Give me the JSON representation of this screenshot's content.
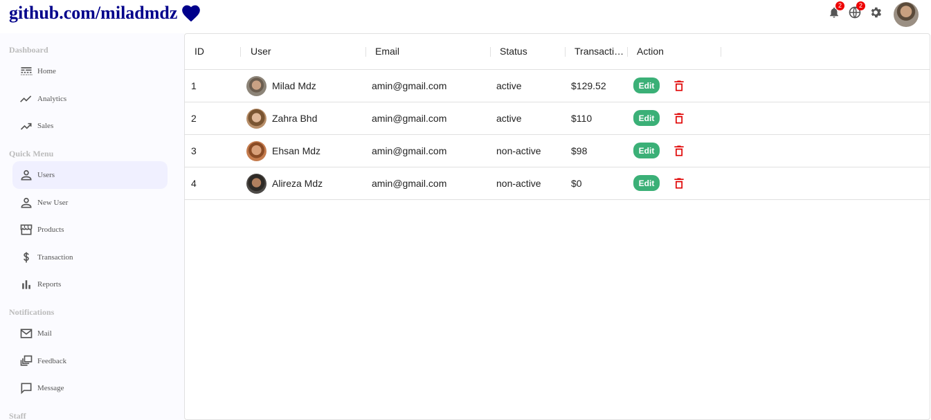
{
  "header": {
    "logo_text": "github.com/miladmdz",
    "notifications_count": "2",
    "language_count": "2"
  },
  "colors": {
    "logo": "#00008b",
    "edit_button": "#3bb077",
    "delete_icon": "#e00000",
    "badge": "#e00000",
    "active_item_bg": "#f0f0ff"
  },
  "sidebar": {
    "sections": {
      "dashboard": "Dashboard",
      "quick_menu": "Quick Menu",
      "notifications": "Notifications",
      "staff": "Staff"
    },
    "items": [
      {
        "label": "Home",
        "icon": "line-style-icon"
      },
      {
        "label": "Analytics",
        "icon": "timeline-icon"
      },
      {
        "label": "Sales",
        "icon": "trending-up-icon"
      },
      {
        "label": "Users",
        "icon": "person-outline-icon",
        "active": true
      },
      {
        "label": "New User",
        "icon": "person-outline-icon"
      },
      {
        "label": "Products",
        "icon": "storefront-icon"
      },
      {
        "label": "Transaction",
        "icon": "dollar-icon"
      },
      {
        "label": "Reports",
        "icon": "bar-chart-icon"
      },
      {
        "label": "Mail",
        "icon": "mail-outline-icon"
      },
      {
        "label": "Feedback",
        "icon": "dynamic-feed-icon"
      },
      {
        "label": "Message",
        "icon": "chat-bubble-outline-icon"
      }
    ]
  },
  "table": {
    "columns": [
      "ID",
      "User",
      "Email",
      "Status",
      "Transaction Volume",
      "Action"
    ],
    "edit_label": "Edit",
    "rows": [
      {
        "id": "1",
        "user": "Milad Mdz",
        "email": "amin@gmail.com",
        "status": "active",
        "transaction": "$129.52"
      },
      {
        "id": "2",
        "user": "Zahra Bhd",
        "email": "amin@gmail.com",
        "status": "active",
        "transaction": "$110"
      },
      {
        "id": "3",
        "user": "Ehsan Mdz",
        "email": "amin@gmail.com",
        "status": "non-active",
        "transaction": "$98"
      },
      {
        "id": "4",
        "user": "Alireza Mdz",
        "email": "amin@gmail.com",
        "status": "non-active",
        "transaction": "$0"
      }
    ]
  }
}
